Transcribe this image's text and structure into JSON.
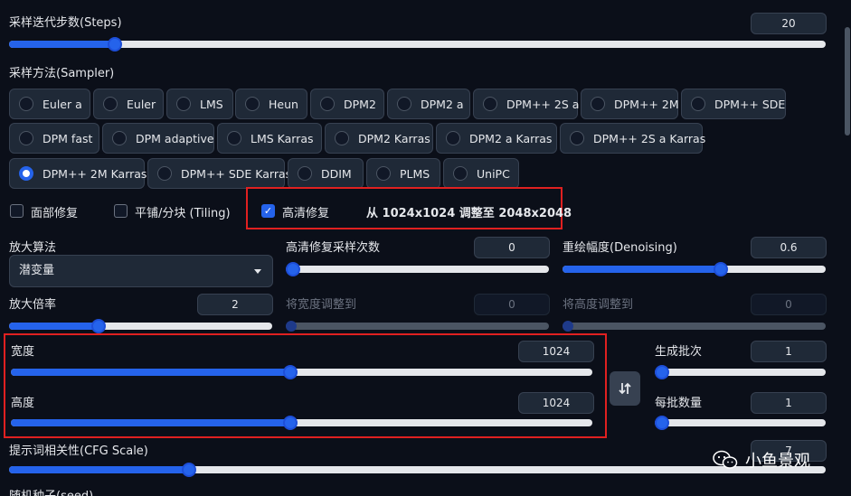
{
  "steps": {
    "label": "采样迭代步数(Steps)",
    "value": "20",
    "fraction": 0.13
  },
  "sampler": {
    "label": "采样方法(Sampler)",
    "options": [
      "Euler a",
      "Euler",
      "LMS",
      "Heun",
      "DPM2",
      "DPM2 a",
      "DPM++ 2S a",
      "DPM++ 2M",
      "DPM++ SDE",
      "DPM fast",
      "DPM adaptive",
      "LMS Karras",
      "DPM2 Karras",
      "DPM2 a Karras",
      "DPM++ 2S a Karras",
      "DPM++ 2M Karras",
      "DPM++ SDE Karras",
      "DDIM",
      "PLMS",
      "UniPC"
    ],
    "selected": "DPM++ 2M Karras"
  },
  "checks": {
    "face_restore": "面部修复",
    "tiling": "平铺/分块 (Tiling)",
    "hires_fix": "高清修复",
    "hires_info": "从 1024x1024 调整至 2048x2048"
  },
  "upscaler": {
    "label": "放大算法",
    "value": "潜变量"
  },
  "hires_steps": {
    "label": "高清修复采样次数",
    "value": "0",
    "fraction": 0.0
  },
  "denoising": {
    "label": "重绘幅度(Denoising)",
    "value": "0.6",
    "fraction": 0.6
  },
  "upscale_by": {
    "label": "放大倍率",
    "value": "2",
    "fraction": 0.34
  },
  "resize_width": {
    "label": "将宽度调整到",
    "value": "0",
    "fraction": 0.0
  },
  "resize_height": {
    "label": "将高度调整到",
    "value": "0",
    "fraction": 0.0
  },
  "width": {
    "label": "宽度",
    "value": "1024",
    "fraction": 0.48
  },
  "height": {
    "label": "高度",
    "value": "1024",
    "fraction": 0.48
  },
  "batch_count": {
    "label": "生成批次",
    "value": "1",
    "fraction": 0.0
  },
  "batch_size": {
    "label": "每批数量",
    "value": "1",
    "fraction": 0.0
  },
  "swap_icon": "swap-vertical-icon",
  "cfg": {
    "label": "提示词相关性(CFG Scale)",
    "value": "7",
    "fraction": 0.22
  },
  "seed": {
    "label": "随机种子(seed)"
  },
  "watermark": {
    "text": "小鱼景观"
  },
  "colors": {
    "accent": "#2563eb",
    "background": "#0b0f19",
    "highlight_border": "#e02020"
  }
}
